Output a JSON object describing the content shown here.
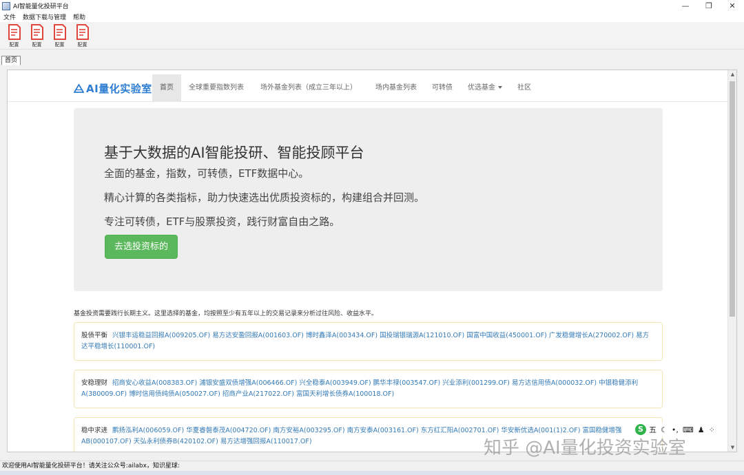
{
  "window": {
    "title": "AI智能量化投研平台",
    "controls": [
      "—",
      "❐",
      "✕"
    ]
  },
  "menu": [
    "文件",
    "数据下载与管理",
    "帮助"
  ],
  "toolbar": {
    "buttons": [
      {
        "label": "配置",
        "icon": "config-doc-icon"
      },
      {
        "label": "配置",
        "icon": "config-doc-icon"
      },
      {
        "label": "配置",
        "icon": "config-doc-icon"
      },
      {
        "label": "配置",
        "icon": "config-doc-icon"
      }
    ],
    "icon_color": "#e0453b"
  },
  "tab": {
    "label": "首页"
  },
  "site": {
    "brand": "AI量化实验室",
    "nav": [
      "首页",
      "全球重要指数列表",
      "场外基金列表（成立三年以上）",
      "场内基金列表",
      "可转债",
      "优选基金",
      "社区"
    ],
    "active_index": 0,
    "brand_color": "#2d7dd2"
  },
  "jumbotron": {
    "title": "基于大数据的AI智能投研、智能投顾平台",
    "lines": [
      "全面的基金，指数，可转债，ETF数据中心。",
      "精心计算的各类指标，助力快速选出优质投资标的，构建组合并回测。",
      "专注可转债，ETF与股票投资，践行财富自由之路。"
    ],
    "button": "去选投资标的",
    "button_color": "#5cb85c"
  },
  "intro": "基金投资需要践行长期主义。这里选择的基金，均按照至少有五年以上的交易记录来分析过往风险、收益水平。",
  "cards": [
    {
      "category": "股债平衡",
      "funds": [
        "兴银丰运稳益回报A(009205.OF)",
        "易方达安盈回报A(001603.OF)",
        "博时鑫泽A(003434.OF)",
        "国投瑞银瑞源A(121010.OF)",
        "国富中国收益(450001.OF)",
        "广发稳健增长A(270002.OF)",
        "易方达平稳增长(110001.OF)"
      ]
    },
    {
      "category": "安稳理财",
      "funds": [
        "招商安心收益A(008383.OF)",
        "浦银安盛双债增强A(006466.OF)",
        "兴全稳泰A(003949.OF)",
        "鹏华丰禄(003547.OF)",
        "兴业添利(001299.OF)",
        "易方达信用债A(000032.OF)",
        "中银稳健添利A(380009.OF)",
        "博时信用债纯债A(050027.OF)",
        "招商产业A(217022.OF)",
        "富国天利增长债券A(100018.OF)"
      ]
    },
    {
      "category": "稳中求进",
      "funds": [
        "鹏扬泓利A(006059.OF)",
        "华夏睿磐泰茂A(004720.OF)",
        "南方安裕A(003295.OF)",
        "南方安泰A(003161.OF)",
        "东方红汇阳A(002701.OF)",
        "华安新优选A(001(1)2.OF)",
        "富国稳健增强AB(000107.OF)",
        "天弘永利债券B(420102.OF)",
        "易方达增强回报A(110017.OF)"
      ]
    }
  ],
  "ime": {
    "logo": "S",
    "items": [
      "五",
      "☾",
      "•,",
      "⌨",
      "♟",
      "⁘"
    ]
  },
  "watermark": "知乎 @AI量化投资实验室",
  "status": "欢迎使用AI智能量化投研平台！请关注公众号:ailabx，知识星球:"
}
